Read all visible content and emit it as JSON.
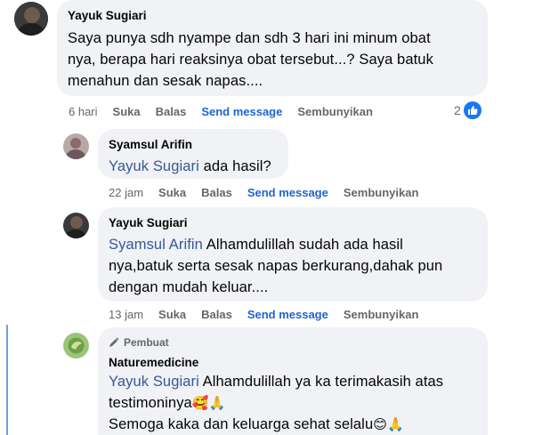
{
  "comments": [
    {
      "author": "Yayuk Sugiari",
      "text": "Saya punya sdh nyampe dan sdh 3 hari ini minum obat nya, berapa hari reaksinya obat tersebut...? Saya batuk menahun dan sesak napas....",
      "lines": [
        "Saya punya sdh nyampe dan sdh 3 hari ini minum obat",
        "nya, berapa hari reaksinya obat tersebut...? Saya batuk",
        "menahun dan sesak napas...."
      ],
      "time": "6 hari",
      "actions": [
        "Suka",
        "Balas",
        "Send message",
        "Sembunyikan"
      ],
      "reaction_count": "2"
    },
    {
      "author": "Syamsul Arifin",
      "mention": "Yayuk Sugiari",
      "text_after_mention": " ada hasil?",
      "time": "22 jam",
      "actions": [
        "Suka",
        "Balas",
        "Send message",
        "Sembunyikan"
      ]
    },
    {
      "author": "Yayuk Sugiari",
      "mention": "Syamsul Arifin",
      "line1_after_mention": " Alhamdulillah sudah ada hasil",
      "line2": "nya,batuk serta sesak napas berkurang,dahak pun",
      "line3": "dengan mudah keluar....",
      "time": "13 jam",
      "actions": [
        "Suka",
        "Balas",
        "Send message",
        "Sembunyikan"
      ]
    },
    {
      "badge": "Pembuat",
      "author": "Naturemedicine",
      "mention": "Yayuk Sugiari",
      "line1_after_mention": " Alhamdulillah ya ka terimakasih atas",
      "line2": "testimoninya",
      "line2_emoji": "🥰🙏",
      "line3": "Semoga kaka dan keluarga sehat selalu",
      "line3_emoji": "😊🙏"
    }
  ],
  "colors": {
    "bubble": "#f0f2f5",
    "mention": "#385898",
    "send_message": "#1f64d1",
    "meta": "#65676b",
    "like": "#1a77f2"
  }
}
